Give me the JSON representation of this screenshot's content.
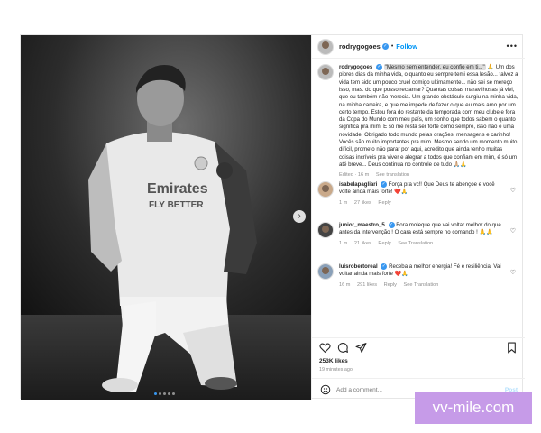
{
  "post": {
    "username": "rodrygogoes",
    "follow_label": "Follow",
    "separator": "•",
    "more_label": "•••"
  },
  "caption": {
    "username": "rodrygogoes",
    "highlight": "\"Mesmo sem entender, eu confio em ti...\"",
    "emoji_hands": "🙏",
    "body": "Um dos piores dias da minha vida, o quanto eu sempre temi essa lesão... talvez a vida tem sido um pouco cruel comigo ultimamente... não sei se mereço isso, mas. do que posso reclamar? Quantas coisas maravilhosas já vivi, que eu também não merecia. Um grande obstáculo surgiu na minha vida, na minha carreira, e que me impede de fazer o que eu mais amo por um certo tempo. Estou fora do restante da temporada com meu clube e fora da Copa do Mundo com meu país, um sonho que todos sabem o quanto significa pra mim. E só me resta ser forte como sempre, isso não é uma novidade. Obrigado todo mundo pelas orações, mensagens e carinho! Vocês são muito importantes pra mim. Mesmo sendo um momento muito difícil, prometo não parar por aqui, acredito que ainda tenho muitas coisas incríveis pra viver e alegrar a todos que confiam em mim, é só um até breve... Deus continua no controle de tudo 🙏🏼🙏",
    "edited": "Edited · 16 m",
    "see_translation": "See translation"
  },
  "comments": [
    {
      "username": "isabelapagliari",
      "text": "Força pra vc!! Que Deus te abençoe e você volte ainda mais forte! ❤️🙏",
      "time": "1 m",
      "likes": "27 likes",
      "reply": "Reply"
    },
    {
      "username": "junior_maestro_5",
      "text": "Bora moleque que vai voltar melhor do que antes da intervenção ! O cara está sempre no comando ! 🙏🙏",
      "time": "1 m",
      "likes": "21 likes",
      "reply": "Reply",
      "see_translation": "See Translation"
    },
    {
      "username": "luisrobertoreal",
      "text": "Receba a melhor energia! Fé e resiliência. Vai voltar ainda mais forte ❤️🙏",
      "time": "16 m",
      "likes": "291 likes",
      "reply": "Reply",
      "see_translation": "See Translation"
    }
  ],
  "stats": {
    "likes": "253K likes",
    "time_ago": "19 minutes ago"
  },
  "composer": {
    "placeholder": "Add a comment...",
    "post_label": "Post"
  },
  "watermark": "vv-mile.com",
  "colors": {
    "accent": "#0095f6",
    "verified": "#3897f0",
    "muted": "#8e8e8e",
    "watermark_bg": "#c69be8"
  }
}
